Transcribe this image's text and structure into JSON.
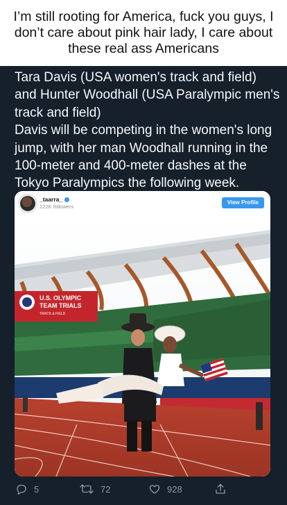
{
  "meme": {
    "caption": "I’m still rooting for America, fuck you guys, I don’t care about pink hair lady, I care about these real ass Americans"
  },
  "tweet": {
    "text_p1": "Tara Davis (USA women's track and field) and Hunter Woodhall (USA Paralympic men's track and field)",
    "text_p2": "Davis will be competing in the women's long jump, with her man Woodhall running in the 100-meter and 400-meter dashes at the Tokyo Paralympics the following week.",
    "embed": {
      "username": "_taarra_",
      "followers": "222K followers",
      "view_profile_label": "View Profile",
      "banner_text_line1": "U.S. OLYMPIC",
      "banner_text_line2": "TEAM TRIALS",
      "banner_text_line3": "TRACK & FIELD"
    },
    "actions": {
      "replies": "5",
      "retweets": "72",
      "likes": "928"
    }
  },
  "colors": {
    "tweet_bg": "#15202b",
    "action_gray": "#8899a6",
    "instagram_blue": "#3897f0"
  },
  "icons": [
    "reply-icon",
    "retweet-icon",
    "like-icon",
    "share-icon",
    "verified-badge-icon"
  ]
}
